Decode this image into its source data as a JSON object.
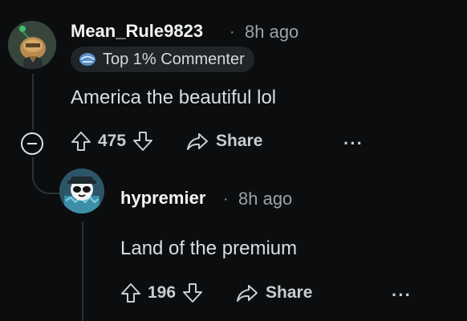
{
  "comment": {
    "author": "Mean_Rule9823",
    "separator": "·",
    "time": "8h ago",
    "badge": {
      "icon": "commenter-badge-icon",
      "label": "Top 1% Commenter"
    },
    "text": "America the beautiful lol",
    "votes": "475",
    "share_label": "Share",
    "more_label": "···"
  },
  "reply": {
    "author": "hypremier",
    "separator": "·",
    "time": "8h ago",
    "text": "Land of the premium",
    "votes": "196",
    "share_label": "Share",
    "more_label": "···"
  },
  "colors": {
    "background": "#0b0d0e",
    "text": "#d9dee0",
    "muted": "#9aa4a8",
    "thread_line": "#2a3236"
  }
}
